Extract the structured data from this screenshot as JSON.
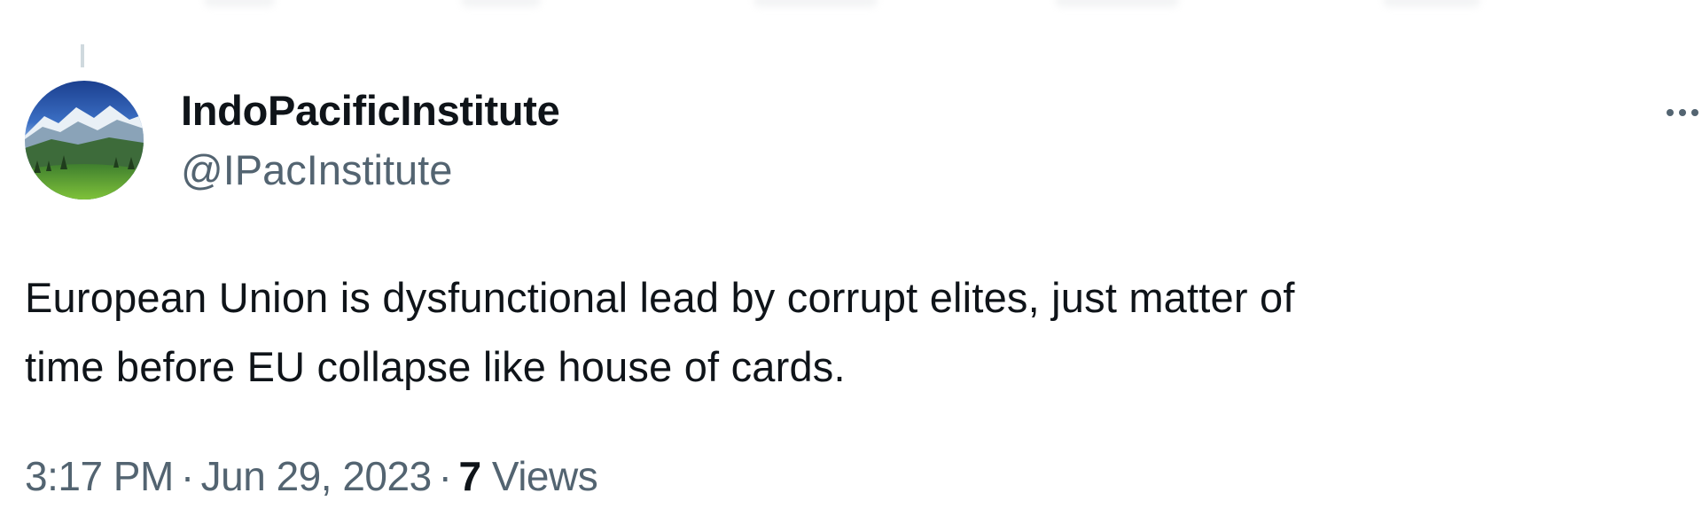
{
  "tweet": {
    "author": {
      "display_name": "IndoPacificInstitute",
      "handle": "@IPacInstitute",
      "avatar_icon": "mountain-landscape-avatar"
    },
    "text_lines": [
      "European Union is dysfunctional lead by corrupt elites, just matter of",
      "time before EU collapse like house of cards."
    ],
    "time": "3:17 PM",
    "separator": "·",
    "date": "Jun 29, 2023",
    "views_count": "7",
    "views_label": "Views",
    "more_icon": "more-options-icon"
  },
  "colors": {
    "primary_text": "#0f1419",
    "secondary_text": "#536471",
    "thread_line": "#cfd9de"
  }
}
